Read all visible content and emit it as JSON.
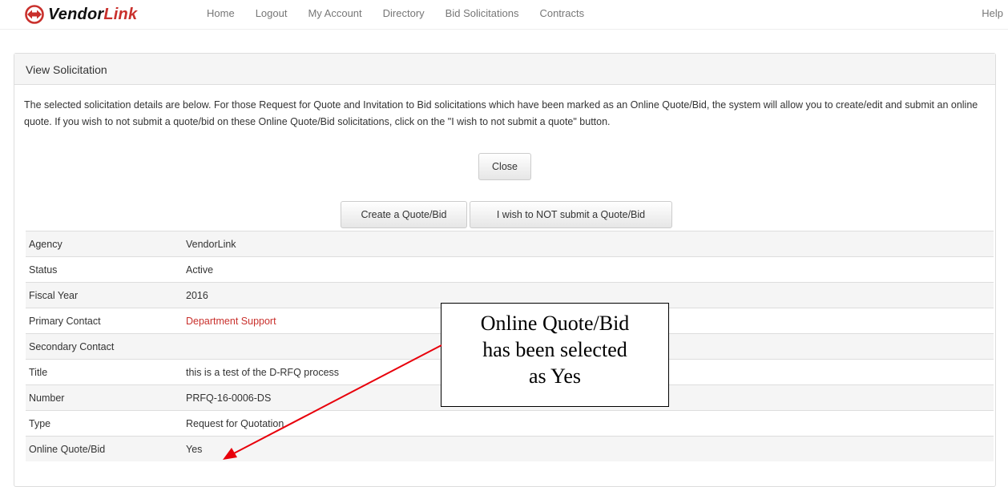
{
  "brand": {
    "name_part1": "Vendor",
    "name_part2": "Link"
  },
  "nav": {
    "items": [
      {
        "label": "Home"
      },
      {
        "label": "Logout"
      },
      {
        "label": "My Account"
      },
      {
        "label": "Directory"
      },
      {
        "label": "Bid Solicitations"
      },
      {
        "label": "Contracts"
      }
    ],
    "help": "Help"
  },
  "panel": {
    "title": "View Solicitation",
    "intro": "The selected solicitation details are below. For those Request for Quote and Invitation to Bid solicitations which have been marked as an Online Quote/Bid, the system will allow you to create/edit and submit an online quote. If you wish to not submit a quote/bid on these Online Quote/Bid solicitations, click on the \"I wish to not submit a quote\" button.",
    "close_label": "Close",
    "create_label": "Create a Quote/Bid",
    "no_submit_label": "I wish to NOT submit a Quote/Bid"
  },
  "details": [
    {
      "label": "Agency",
      "value": "VendorLink"
    },
    {
      "label": "Status",
      "value": "Active"
    },
    {
      "label": "Fiscal Year",
      "value": "2016"
    },
    {
      "label": "Primary Contact",
      "value": "Department Support"
    },
    {
      "label": "Secondary Contact",
      "value": ""
    },
    {
      "label": "Title",
      "value": "this is a test of the D-RFQ process"
    },
    {
      "label": "Number",
      "value": "PRFQ-16-0006-DS"
    },
    {
      "label": "Type",
      "value": "Request for Quotation"
    },
    {
      "label": "Online Quote/Bid",
      "value": "Yes"
    }
  ],
  "callout": {
    "line1": "Online Quote/Bid",
    "line2": "has been selected",
    "line3": "as Yes"
  },
  "colors": {
    "link": "#c9302c",
    "arrow": "#e8000b"
  }
}
